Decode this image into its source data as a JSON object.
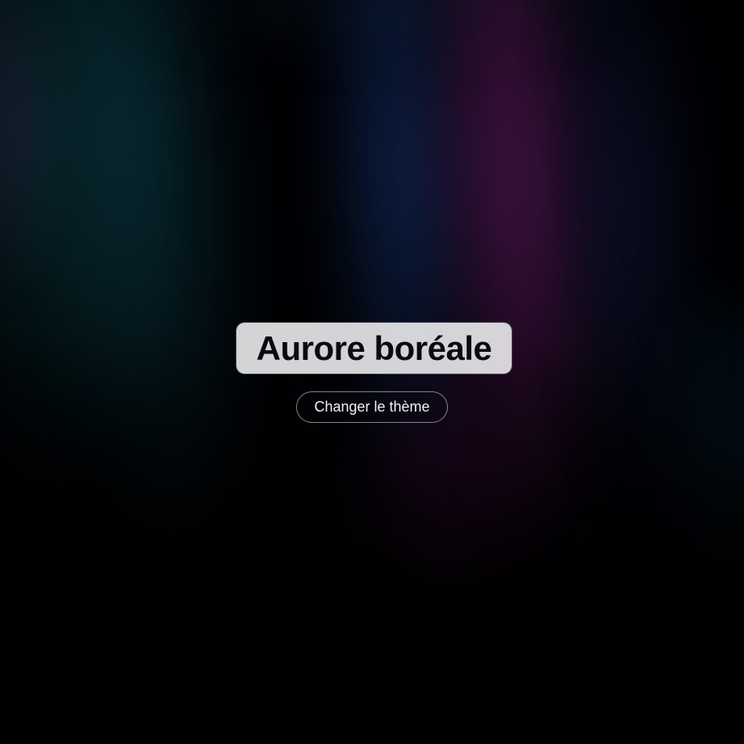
{
  "page": {
    "title": "Aurore boréale",
    "button_label": "Changer le thème"
  },
  "background": {
    "style": "aurora",
    "base_color": "#010103",
    "colors": [
      "#08303a",
      "#143270",
      "#5c1a5c",
      "#46103f"
    ]
  }
}
